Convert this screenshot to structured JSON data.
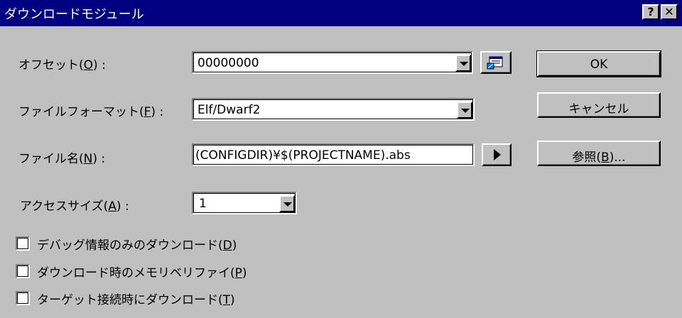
{
  "window": {
    "title": "ダウンロードモジュール",
    "help_label": "?",
    "close_label": "✕"
  },
  "offset": {
    "label": "オフセット",
    "mnemonic": "O",
    "value": "00000000"
  },
  "file_format": {
    "label": "ファイルフォーマット",
    "mnemonic": "F",
    "value": "Elf/Dwarf2"
  },
  "file_name": {
    "label": "ファイル名",
    "mnemonic": "N",
    "value": "(CONFIGDIR)¥$(PROJECTNAME).abs"
  },
  "access_size": {
    "label": "アクセスサイズ",
    "mnemonic": "A",
    "value": "1"
  },
  "buttons": {
    "ok": "OK",
    "cancel": "キャンセル",
    "browse": "参照",
    "browse_mnemonic": "B",
    "browse_suffix": "..."
  },
  "checkboxes": [
    {
      "label": "デバッグ情報のみのダウンロード",
      "mnemonic": "D",
      "checked": false
    },
    {
      "label": "ダウンロード時のメモリベリファイ",
      "mnemonic": "P",
      "checked": false
    },
    {
      "label": "ターゲット接続時にダウンロード",
      "mnemonic": "T",
      "checked": false
    }
  ],
  "colors": {
    "titlebar": "#000080",
    "face": "#c0c0c0"
  },
  "icons": {
    "offset_picker": "memory-map-icon",
    "file_name_menu": "right-arrow-icon"
  }
}
